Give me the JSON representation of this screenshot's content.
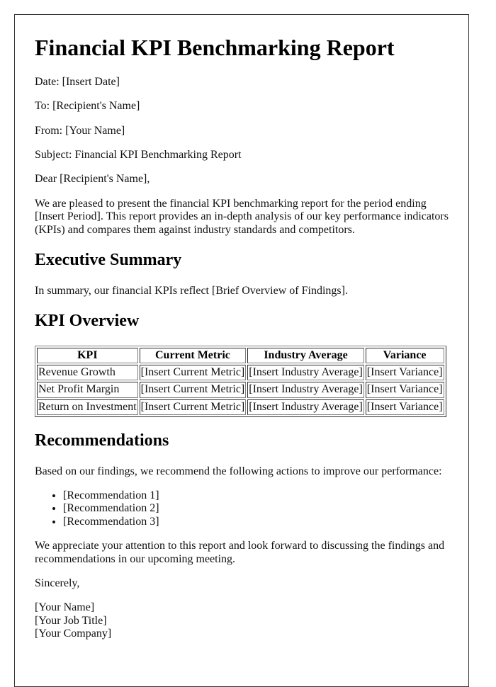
{
  "document": {
    "title": "Financial KPI Benchmarking Report",
    "header_fields": [
      "Date: [Insert Date]",
      "To: [Recipient's Name]",
      "From: [Your Name]",
      "Subject: Financial KPI Benchmarking Report"
    ],
    "salutation": "Dear [Recipient's Name],",
    "intro": "We are pleased to present the financial KPI benchmarking report for the period ending [Insert Period]. This report provides an in-depth analysis of our key performance indicators (KPIs) and compares them against industry standards and competitors.",
    "sections": {
      "executive_summary": {
        "heading": "Executive Summary",
        "text": "In summary, our financial KPIs reflect [Brief Overview of Findings]."
      },
      "kpi_overview": {
        "heading": "KPI Overview",
        "table": {
          "headers": [
            "KPI",
            "Current Metric",
            "Industry Average",
            "Variance"
          ],
          "rows": [
            [
              "Revenue Growth",
              "[Insert Current Metric]",
              "[Insert Industry Average]",
              "[Insert Variance]"
            ],
            [
              "Net Profit Margin",
              "[Insert Current Metric]",
              "[Insert Industry Average]",
              "[Insert Variance]"
            ],
            [
              "Return on Investment",
              "[Insert Current Metric]",
              "[Insert Industry Average]",
              "[Insert Variance]"
            ]
          ]
        }
      },
      "recommendations": {
        "heading": "Recommendations",
        "intro": "Based on our findings, we recommend the following actions to improve our performance:",
        "items": [
          "[Recommendation 1]",
          "[Recommendation 2]",
          "[Recommendation 3]"
        ]
      }
    },
    "closing_paragraph": "We appreciate your attention to this report and look forward to discussing the findings and recommendations in our upcoming meeting.",
    "sign_off": "Sincerely,",
    "signature": {
      "name": "[Your Name]",
      "job_title": "[Your Job Title]",
      "company": "[Your Company]"
    }
  }
}
